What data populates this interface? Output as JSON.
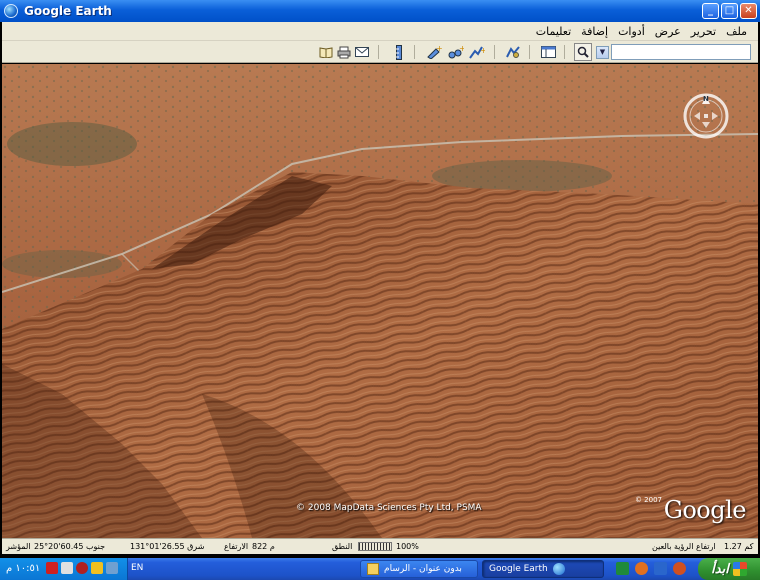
{
  "window": {
    "title": "Google Earth",
    "minimize_glyph": "_",
    "maximize_glyph": "□",
    "close_glyph": "✕"
  },
  "menu": {
    "items": [
      "ملف",
      "تحرير",
      "عرض",
      "أدوات",
      "إضافة",
      "تعليمات"
    ]
  },
  "toolbar": {
    "icons": [
      "book-icon",
      "print-icon",
      "email-icon",
      "ruler-icon",
      "add-placemark-icon",
      "add-polygon-icon",
      "add-path-icon",
      "sky-toggle-icon",
      "sidebar-toggle-icon"
    ],
    "search_value": ""
  },
  "map": {
    "copyright": "© 2008 MapData Sciences Pty Ltd, PSMA",
    "logo_year": "© 2007",
    "logo_text": "Google",
    "compass_letter": "N"
  },
  "status": {
    "pointer_label": "المؤشر",
    "latitude": "25°20'60.45 جنوب",
    "longitude": "131°01'26.55 شرق",
    "elevation_label": "الارتفاع",
    "elevation_value": "822 م",
    "streaming_label": "النطق",
    "streaming_value": "100%",
    "eye_alt_label": "ارتفاع الرؤية بالعين",
    "eye_alt_value": "1.27 كم"
  },
  "taskbar": {
    "clock": "١٠:٥١ م",
    "language": "EN",
    "task_paint": "بدون عنوان - الرسام",
    "task_google_earth": "Google Earth",
    "start_label": "ابدأ"
  }
}
